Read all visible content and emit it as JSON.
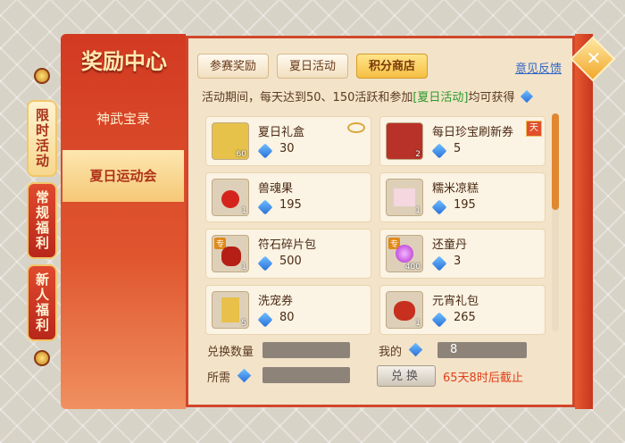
{
  "panel": {
    "title": "奖励中心"
  },
  "left_tabs": [
    {
      "label": "限时活动",
      "active": true
    },
    {
      "label": "常规福利",
      "active": false
    },
    {
      "label": "新人福利",
      "active": false
    }
  ],
  "side_menu": [
    {
      "label": "神武宝录",
      "active": false
    },
    {
      "label": "夏日运动会",
      "active": true
    }
  ],
  "tabs": [
    {
      "label": "参赛奖励",
      "active": false
    },
    {
      "label": "夏日活动",
      "active": false
    },
    {
      "label": "积分商店",
      "active": true
    }
  ],
  "feedback_link": "意见反馈",
  "notice": {
    "prefix": "活动期间，每天达到50、150活跃和参加",
    "highlight": "[夏日活动]",
    "suffix": "均可获得"
  },
  "items": [
    {
      "name": "夏日礼盒",
      "price": "30",
      "qty": "60",
      "has_eye": true
    },
    {
      "name": "每日珍宝刷新券",
      "price": "5",
      "qty": "2",
      "badge": "天"
    },
    {
      "name": "兽魂果",
      "price": "195",
      "qty": "1"
    },
    {
      "name": "糯米凉糕",
      "price": "195",
      "qty": "1"
    },
    {
      "name": "符石碎片包",
      "price": "500",
      "qty": "1",
      "tag": "专"
    },
    {
      "name": "还童丹",
      "price": "3",
      "qty": "400",
      "tag": "专"
    },
    {
      "name": "洗宠券",
      "price": "80",
      "qty": "5"
    },
    {
      "name": "元宵礼包",
      "price": "265",
      "qty": "1"
    }
  ],
  "exchange": {
    "qty_label": "兑换数量",
    "mine_label": "我的",
    "mine_value": "8",
    "need_label": "所需",
    "button": "兑换",
    "deadline": "65天8时后截止"
  },
  "icons": [
    "currency-gem-icon",
    "eye-icon",
    "close-icon"
  ]
}
